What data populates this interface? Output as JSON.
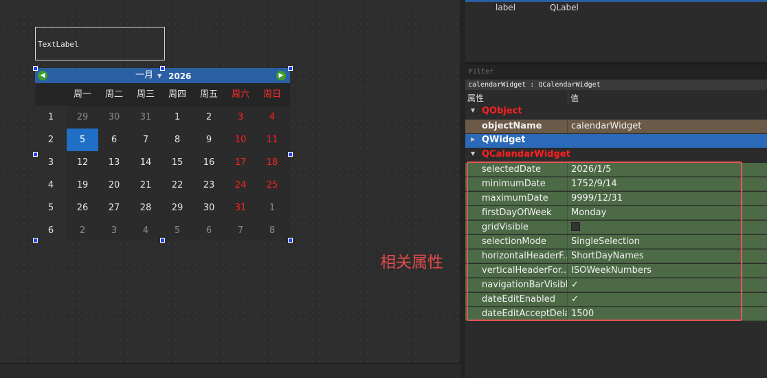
{
  "form": {
    "text_label": "TextLabel"
  },
  "calendar": {
    "month": "一月",
    "year": "2026",
    "weekdays": [
      "周一",
      "周二",
      "周三",
      "周四",
      "周五",
      "周六",
      "周日"
    ],
    "week_numbers": [
      "1",
      "2",
      "3",
      "4",
      "5",
      "6"
    ],
    "days": [
      [
        "29",
        "30",
        "31",
        "1",
        "2",
        "3",
        "4"
      ],
      [
        "5",
        "6",
        "7",
        "8",
        "9",
        "10",
        "11"
      ],
      [
        "12",
        "13",
        "14",
        "15",
        "16",
        "17",
        "18"
      ],
      [
        "19",
        "20",
        "21",
        "22",
        "23",
        "24",
        "25"
      ],
      [
        "26",
        "27",
        "28",
        "29",
        "30",
        "31",
        "1"
      ],
      [
        "2",
        "3",
        "4",
        "5",
        "6",
        "7",
        "8"
      ]
    ],
    "selected_day": "5",
    "colors": {
      "weekend": "#ff2020",
      "selection": "#1f6fc6",
      "nav_bar": "#2a5fa3"
    }
  },
  "annotation": "相关属性",
  "object_inspector": {
    "rows": [
      {
        "name": "label",
        "class": "QLabel"
      }
    ]
  },
  "property_editor": {
    "filter_placeholder": "Filter",
    "class_line": "calendarWidget : QCalendarWidget",
    "header": {
      "property": "属性",
      "value": "值"
    },
    "groups": {
      "qobject": "QObject",
      "qwidget": "QWidget",
      "qcalendar": "QCalendarWidget"
    },
    "object_name": {
      "name": "objectName",
      "value": "calendarWidget"
    },
    "properties": [
      {
        "name": "selectedDate",
        "value": "2026/1/5"
      },
      {
        "name": "minimumDate",
        "value": "1752/9/14"
      },
      {
        "name": "maximumDate",
        "value": "9999/12/31"
      },
      {
        "name": "firstDayOfWeek",
        "value": "Monday"
      },
      {
        "name": "gridVisible",
        "value": ""
      },
      {
        "name": "selectionMode",
        "value": "SingleSelection"
      },
      {
        "name": "horizontalHeaderF...",
        "value": "ShortDayNames"
      },
      {
        "name": "verticalHeaderFor...",
        "value": "ISOWeekNumbers"
      },
      {
        "name": "navigationBarVisible",
        "value": "✓"
      },
      {
        "name": "dateEditEnabled",
        "value": "✓"
      },
      {
        "name": "dateEditAcceptDelay",
        "value": "1500"
      }
    ],
    "colors": {
      "property_row": "#4d6a46",
      "highlight_box": "#e85555",
      "group_text": "#ff2020"
    }
  }
}
